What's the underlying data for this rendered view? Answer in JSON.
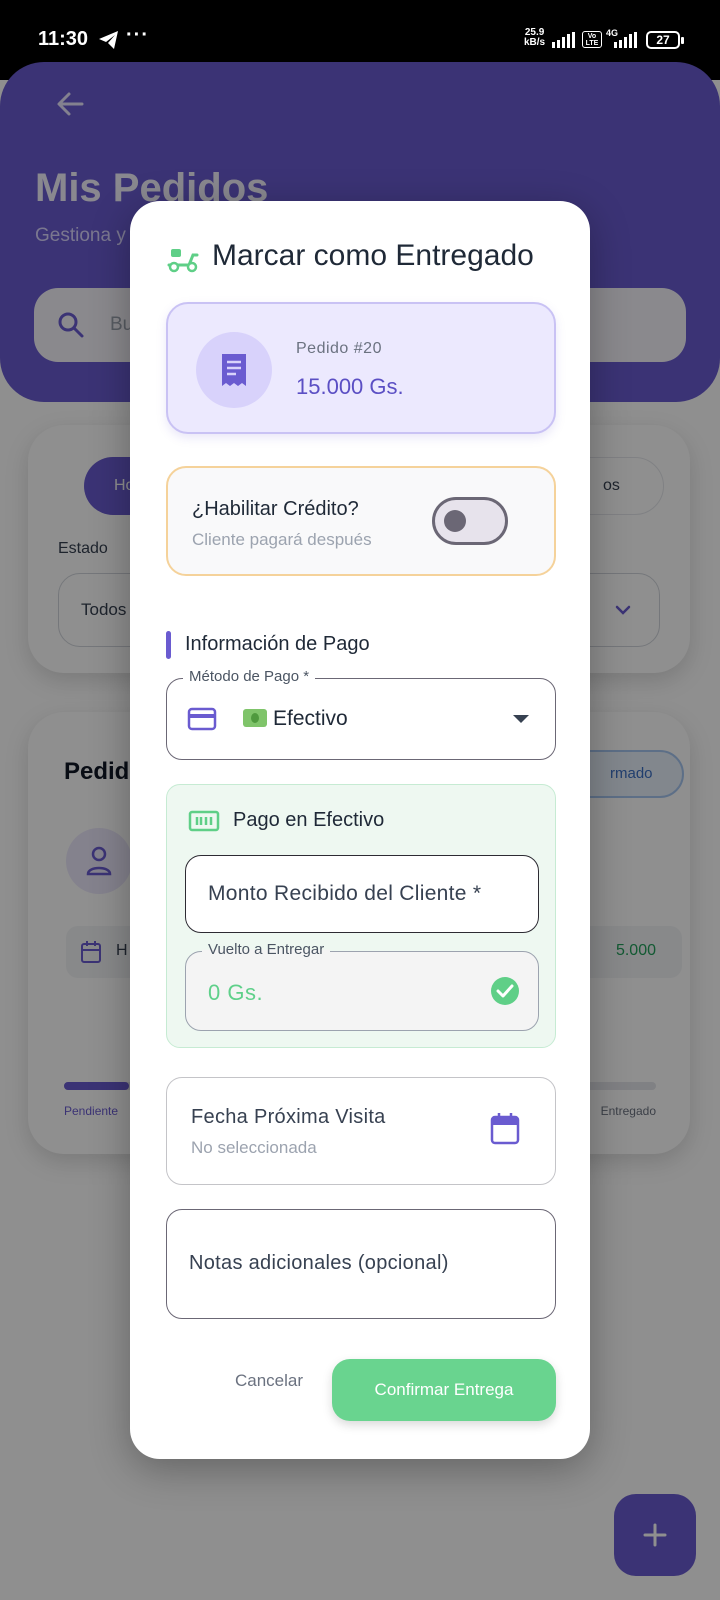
{
  "status_bar": {
    "time": "11:30",
    "more": "···",
    "net_speed_value": "25.9",
    "net_speed_unit": "kB/s",
    "volte": "Vo LTE",
    "network": "4G",
    "battery": "27"
  },
  "background": {
    "title": "Mis Pedidos",
    "subtitle": "Gestiona y",
    "search_placeholder": "Bu",
    "chip_active": "Ho",
    "chip_right": "os",
    "estado_label": "Estado",
    "estado_value": "Todos",
    "pedidos_title": "Pedid",
    "status_pill": "rmado",
    "date_text": "H",
    "amount": "5.000",
    "progress_left": "Pendiente",
    "progress_right": "Entregado",
    "progress_fraction": 0.11
  },
  "dialog": {
    "title": "Marcar como Entregado",
    "order": {
      "number": "Pedido #20",
      "amount": "15.000 Gs."
    },
    "credit": {
      "title": "¿Habilitar Crédito?",
      "subtitle": "Cliente pagará después",
      "enabled": false
    },
    "payment_section_title": "Información de Pago",
    "payment_method": {
      "label": "Método de Pago *",
      "value": "Efectivo"
    },
    "cash": {
      "title": "Pago en Efectivo",
      "received_placeholder": "Monto Recibido del Cliente *",
      "change_label": "Vuelto a Entregar",
      "change_value": "0 Gs."
    },
    "next_visit": {
      "label": "Fecha Próxima Visita",
      "value": "No seleccionada"
    },
    "notes_placeholder": "Notas adicionales (opcional)",
    "cancel_label": "Cancelar",
    "confirm_label": "Confirmar Entrega"
  },
  "colors": {
    "primary": "#6a5bd0",
    "success": "#69d48f",
    "warning_border": "#f5d29a"
  }
}
